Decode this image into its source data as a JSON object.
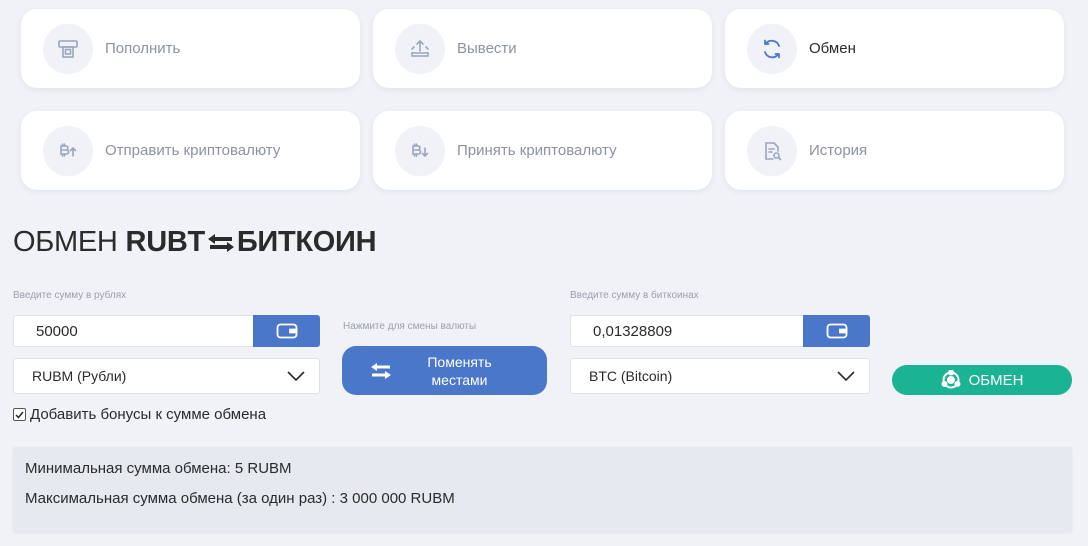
{
  "actions": [
    {
      "label": "Пополнить",
      "icon": "atm-icon",
      "active": false
    },
    {
      "label": "Вывести",
      "icon": "upload-tray-icon",
      "active": false
    },
    {
      "label": "Обмен",
      "icon": "refresh-icon",
      "active": true
    },
    {
      "label": "Отправить криптовалюту",
      "icon": "bitcoin-send-icon",
      "active": false
    },
    {
      "label": "Принять криптовалюту",
      "icon": "bitcoin-receive-icon",
      "active": false
    },
    {
      "label": "История",
      "icon": "document-search-icon",
      "active": false
    }
  ],
  "exchange": {
    "title_prefix": "ОБМЕН",
    "title_from": "RUBT",
    "title_to": "БИТКОИН",
    "rub": {
      "label": "Введите сумму в рублях",
      "amount": "50000",
      "currency": "RUBM (Рубли)"
    },
    "swap": {
      "hint": "Нажмите для смены валюты",
      "label": "Поменять местами"
    },
    "btc": {
      "label": "Введите сумму в биткоинах",
      "amount": "0,01328809",
      "currency": "BTC (Bitcoin)"
    },
    "exchange_label": "ОБМЕН",
    "bonus": {
      "label": "Добавить бонусы к сумме обмена",
      "checked": true
    },
    "info": {
      "min": "Минимальная сумма обмена: 5 RUBM",
      "max": "Максимальная сумма обмена (за один раз) : 3 000 000 RUBM"
    }
  },
  "colors": {
    "primary": "#4a77c9",
    "accent_green": "#1ab394",
    "background": "#f0f2f7",
    "icon_muted": "#9aa6bd"
  }
}
